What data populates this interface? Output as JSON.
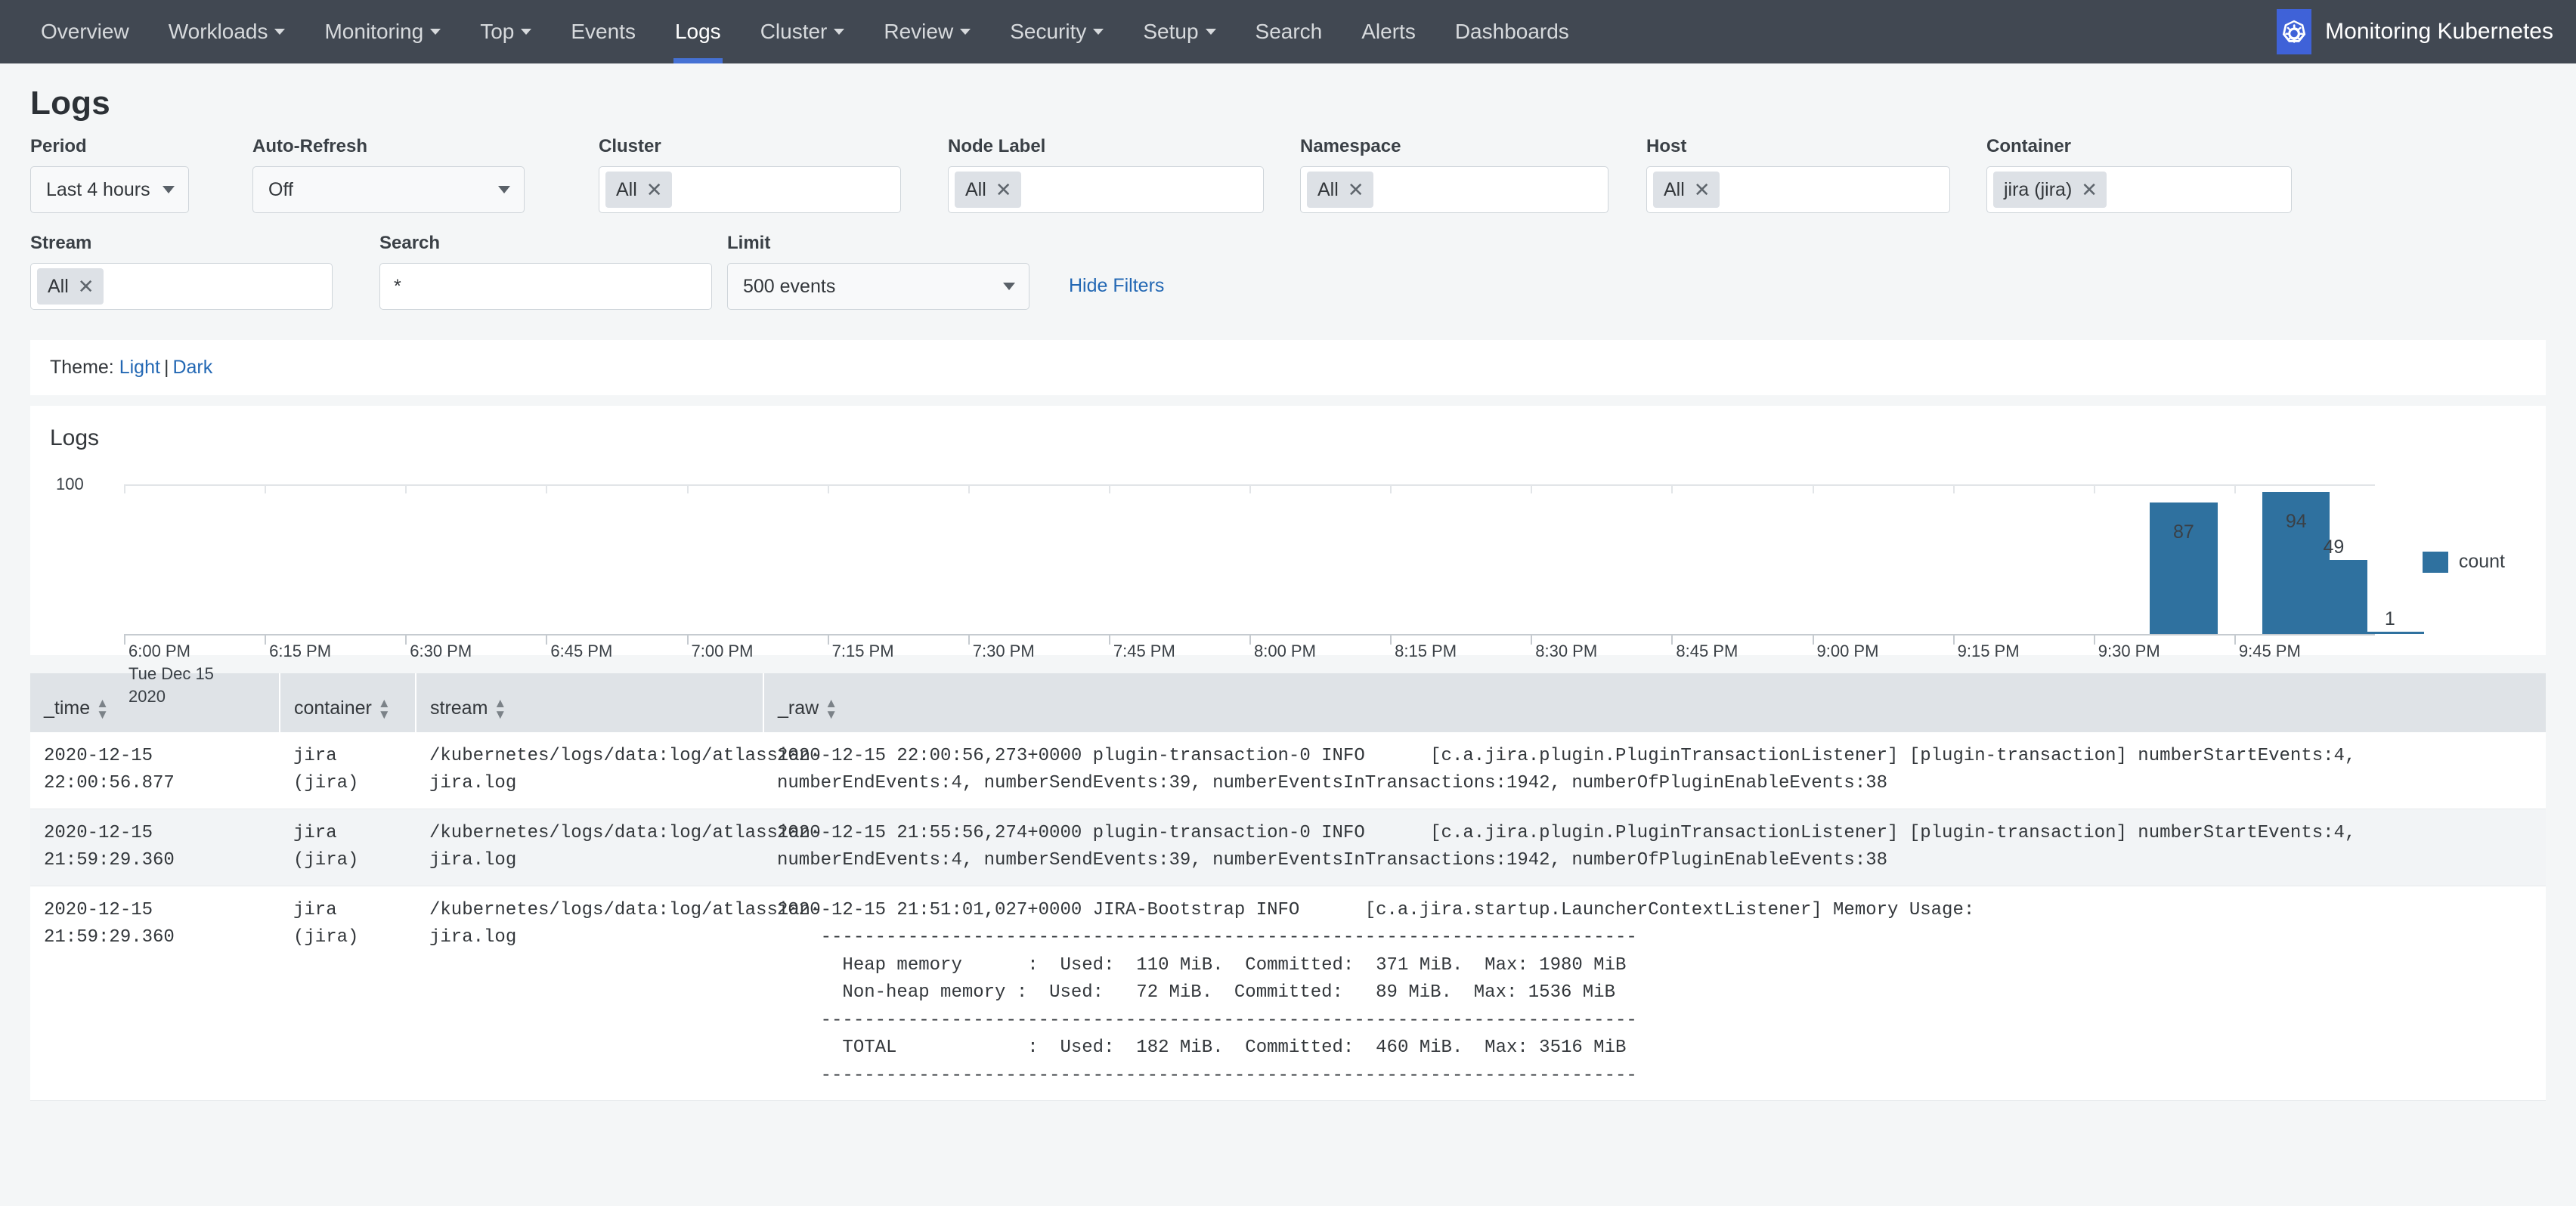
{
  "navbar": {
    "items": [
      {
        "label": "Overview",
        "caret": false,
        "active": false
      },
      {
        "label": "Workloads",
        "caret": true,
        "active": false
      },
      {
        "label": "Monitoring",
        "caret": true,
        "active": false
      },
      {
        "label": "Top",
        "caret": true,
        "active": false
      },
      {
        "label": "Events",
        "caret": false,
        "active": false
      },
      {
        "label": "Logs",
        "caret": false,
        "active": true
      },
      {
        "label": "Cluster",
        "caret": true,
        "active": false
      },
      {
        "label": "Review",
        "caret": true,
        "active": false
      },
      {
        "label": "Security",
        "caret": true,
        "active": false
      },
      {
        "label": "Setup",
        "caret": true,
        "active": false
      },
      {
        "label": "Search",
        "caret": false,
        "active": false
      },
      {
        "label": "Alerts",
        "caret": false,
        "active": false
      },
      {
        "label": "Dashboards",
        "caret": false,
        "active": false
      }
    ],
    "brand_title": "Monitoring Kubernetes",
    "brand_icon": "kubernetes-helm-icon",
    "brand_color": "#3f62d8",
    "background": "#414852",
    "active_underline": "#4571d4"
  },
  "page": {
    "title": "Logs"
  },
  "filters": {
    "period": {
      "label": "Period",
      "value": "Last 4 hours"
    },
    "auto_refresh": {
      "label": "Auto-Refresh",
      "value": "Off"
    },
    "cluster": {
      "label": "Cluster",
      "tokens": [
        "All"
      ],
      "placeholder": ""
    },
    "node_label": {
      "label": "Node Label",
      "tokens": [
        "All"
      ],
      "placeholder": ""
    },
    "namespace": {
      "label": "Namespace",
      "tokens": [
        "All"
      ],
      "placeholder": ""
    },
    "host": {
      "label": "Host",
      "tokens": [
        "All"
      ],
      "placeholder": ""
    },
    "container": {
      "label": "Container",
      "tokens": [
        "jira (jira)"
      ],
      "placeholder": ""
    },
    "stream": {
      "label": "Stream",
      "tokens": [
        "All"
      ],
      "placeholder": ""
    },
    "search": {
      "label": "Search",
      "value": "*",
      "placeholder": ""
    },
    "limit": {
      "label": "Limit",
      "value": "500 events"
    },
    "hide_filters_label": "Hide Filters",
    "token_remove_glyph": "✕"
  },
  "theme_bar": {
    "prefix": "Theme:",
    "light": "Light",
    "separator": "|",
    "dark": "Dark"
  },
  "chart_data": {
    "type": "bar",
    "title": "Logs",
    "xlabel": "",
    "ylabel": "",
    "ylim": [
      0,
      115
    ],
    "yticks": [
      100
    ],
    "ytick_labels": [
      "100"
    ],
    "grid": true,
    "legend_position": "right",
    "series": [
      {
        "name": "count",
        "color": "#2f719f",
        "values": [
          87,
          94,
          49,
          1
        ],
        "x": [
          "9:36 PM",
          "9:48 PM",
          "9:52 PM",
          "9:58 PM"
        ]
      }
    ],
    "bar_labels": [
      "87",
      "94",
      "49",
      "1"
    ],
    "legend": [
      "count"
    ],
    "xtick_labels": [
      "6:00 PM",
      "6:15 PM",
      "6:30 PM",
      "6:45 PM",
      "7:00 PM",
      "7:15 PM",
      "7:30 PM",
      "7:45 PM",
      "8:00 PM",
      "8:15 PM",
      "8:30 PM",
      "8:45 PM",
      "9:00 PM",
      "9:15 PM",
      "9:30 PM",
      "9:45 PM"
    ],
    "xaxis_sub_lines": [
      "Tue Dec 15",
      "2020"
    ],
    "axis_range_start": "6:00 PM",
    "axis_range_end": "10:00 PM"
  },
  "table": {
    "columns": [
      {
        "key": "_time",
        "label": "_time",
        "sortable": true
      },
      {
        "key": "container",
        "label": "container",
        "sortable": true
      },
      {
        "key": "stream",
        "label": "stream",
        "sortable": true
      },
      {
        "key": "_raw",
        "label": "_raw",
        "sortable": true
      }
    ],
    "rows": [
      {
        "_time": "2020-12-15\n22:00:56.877",
        "container": "jira\n(jira)",
        "stream": "/kubernetes/logs/data:log/atlassian-jira.log",
        "_raw": "2020-12-15 22:00:56,273+0000 plugin-transaction-0 INFO      [c.a.jira.plugin.PluginTransactionListener] [plugin-transaction] numberStartEvents:4, numberEndEvents:4, numberSendEvents:39, numberEventsInTransactions:1942, numberOfPluginEnableEvents:38"
      },
      {
        "_time": "2020-12-15\n21:59:29.360",
        "container": "jira\n(jira)",
        "stream": "/kubernetes/logs/data:log/atlassian-jira.log",
        "_raw": "2020-12-15 21:55:56,274+0000 plugin-transaction-0 INFO      [c.a.jira.plugin.PluginTransactionListener] [plugin-transaction] numberStartEvents:4, numberEndEvents:4, numberSendEvents:39, numberEventsInTransactions:1942, numberOfPluginEnableEvents:38"
      },
      {
        "_time": "2020-12-15\n21:59:29.360",
        "container": "jira\n(jira)",
        "stream": "/kubernetes/logs/data:log/atlassian-jira.log",
        "_raw": "2020-12-15 21:51:01,027+0000 JIRA-Bootstrap INFO      [c.a.jira.startup.LauncherContextListener] Memory Usage:\n    ---------------------------------------------------------------------------\n      Heap memory      :  Used:  110 MiB.  Committed:  371 MiB.  Max: 1980 MiB\n      Non-heap memory :  Used:   72 MiB.  Committed:   89 MiB.  Max: 1536 MiB\n    ---------------------------------------------------------------------------\n      TOTAL            :  Used:  182 MiB.  Committed:  460 MiB.  Max: 3516 MiB\n    ---------------------------------------------------------------------------"
      }
    ]
  }
}
